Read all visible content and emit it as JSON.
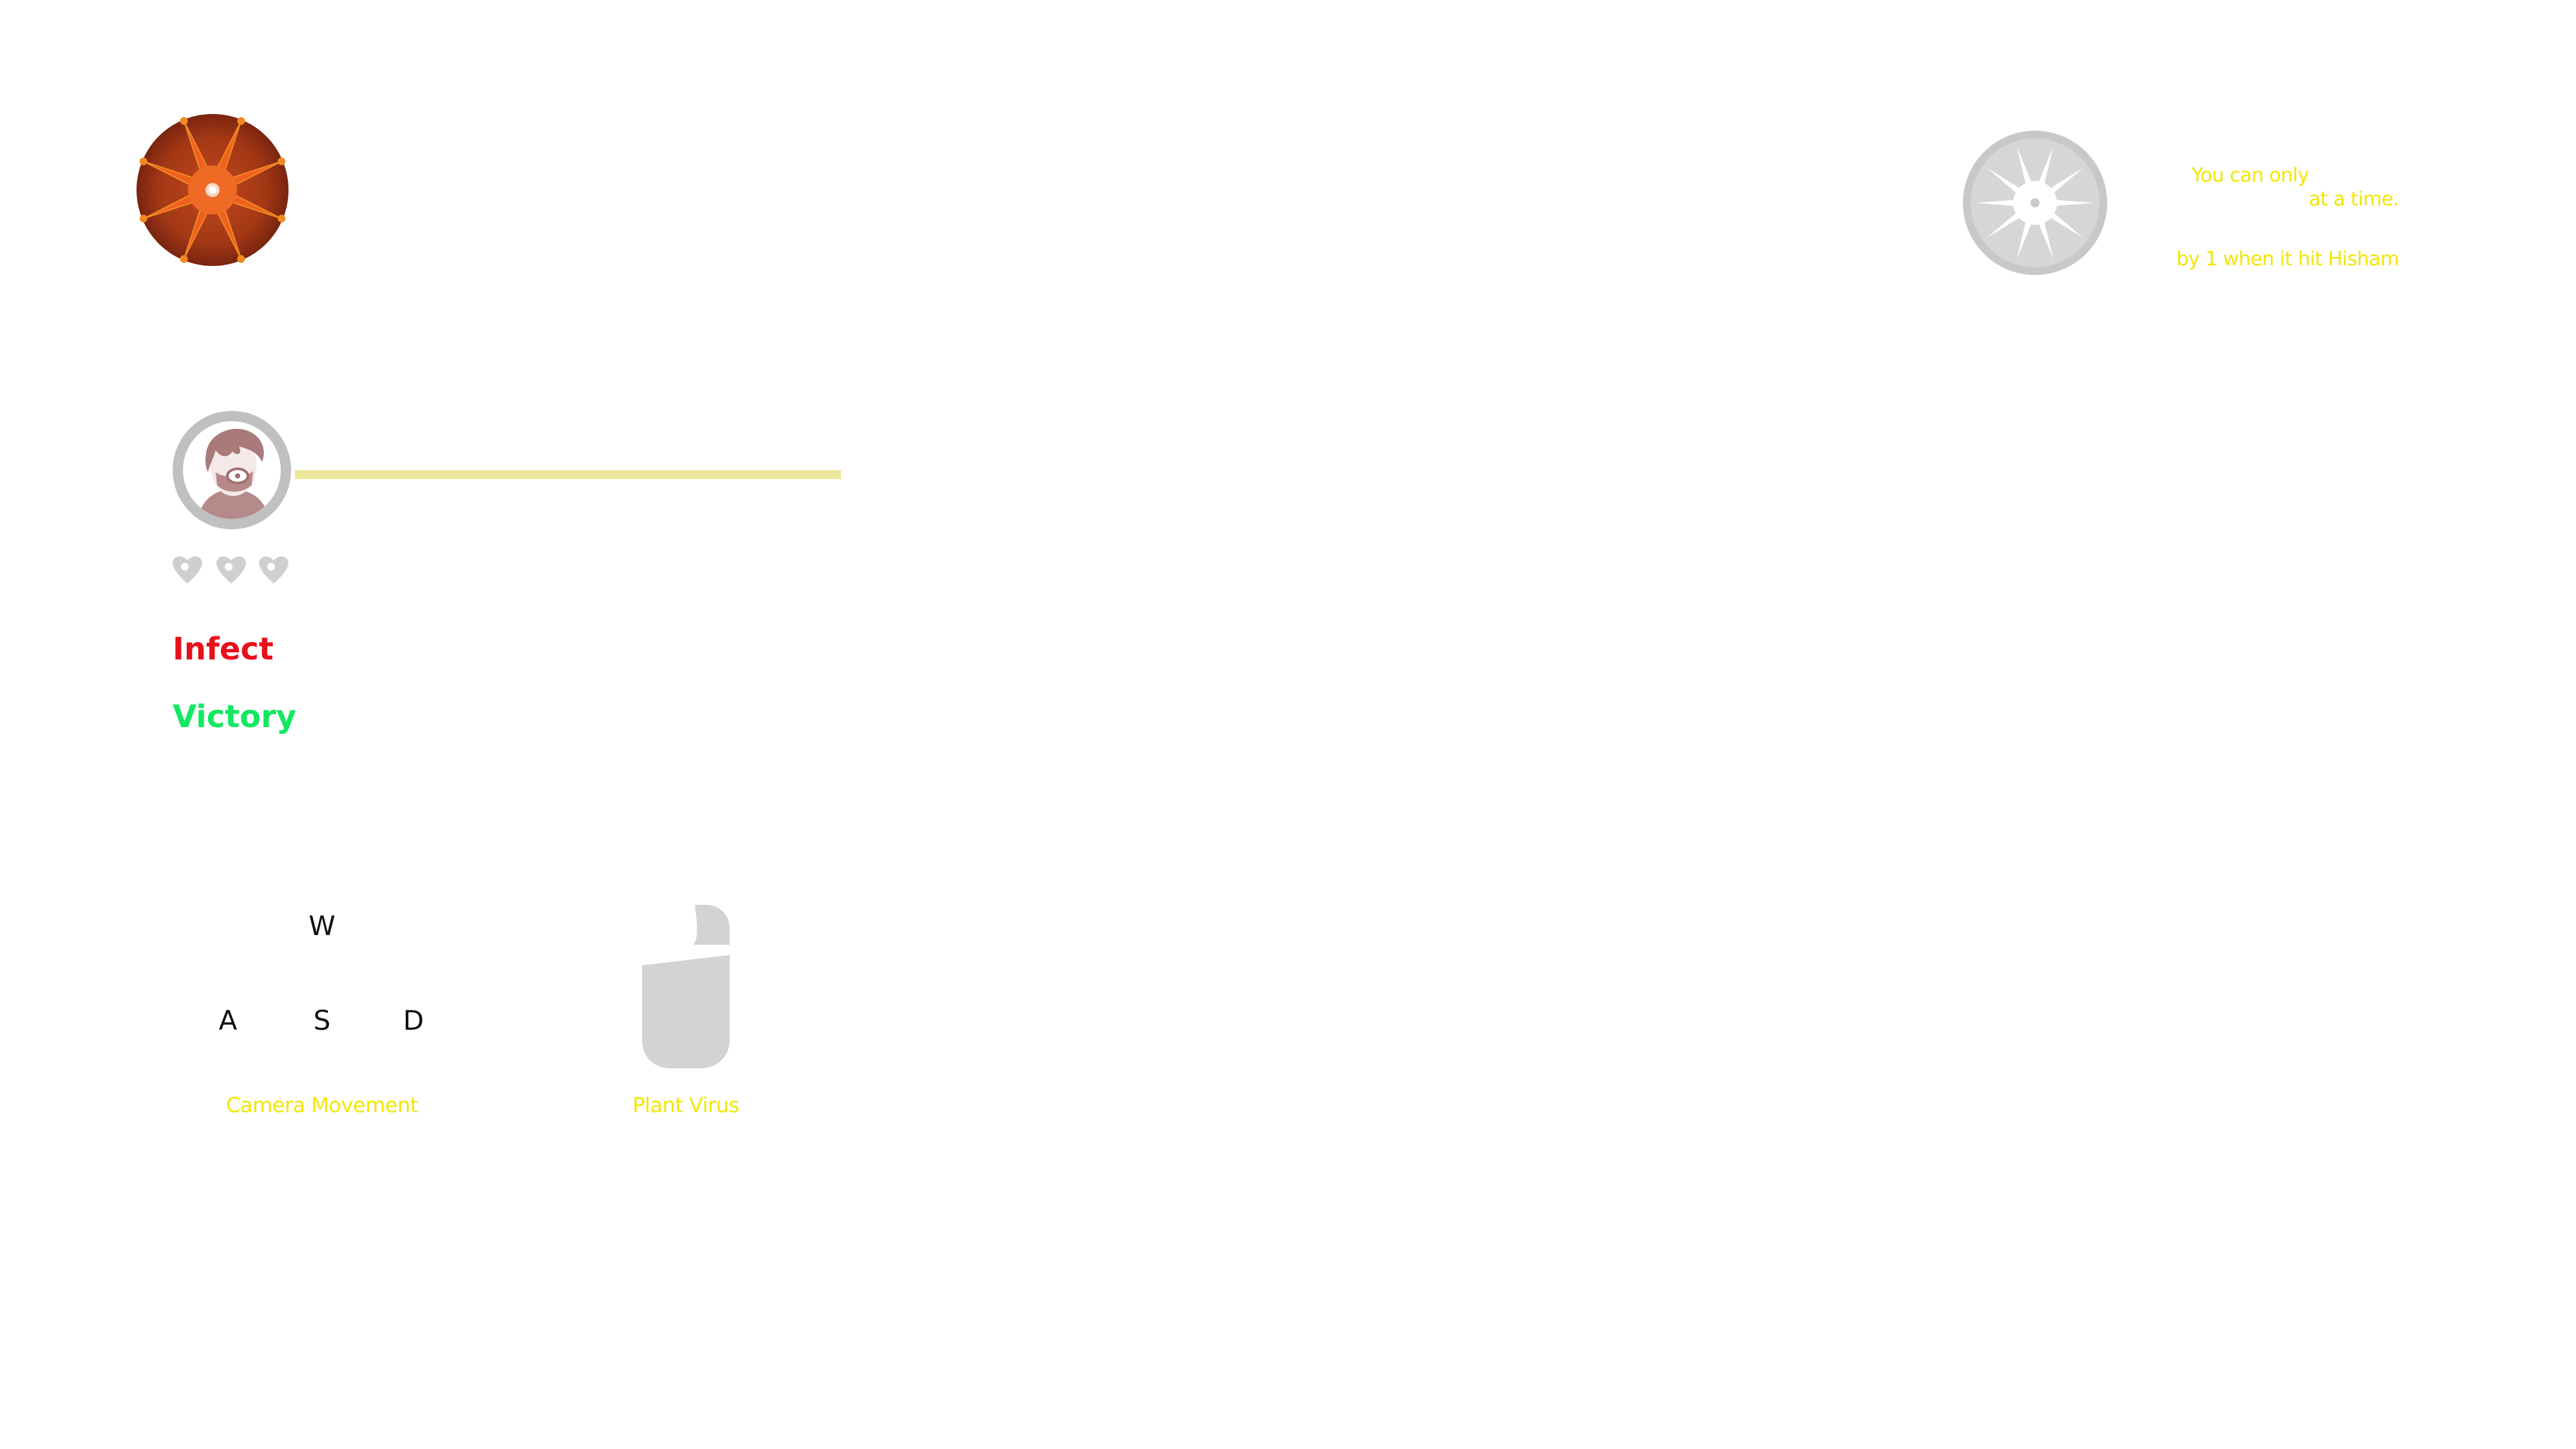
{
  "hud": {
    "virus_icon": "virus-emblem-icon",
    "tip": {
      "icon": "virus-silhouette-icon",
      "line_1": "You can only",
      "line_2": "at a time.",
      "line_3": "by 1 when it hit Hisham"
    }
  },
  "target": {
    "avatar_icon": "masked-person-avatar",
    "progress": 0.0,
    "lives": {
      "icon": "heart-icon",
      "count": 3
    },
    "status": {
      "infect": "Infect",
      "victory": "Victory"
    }
  },
  "controls": {
    "keys": {
      "up": "W",
      "left": "A",
      "down": "S",
      "right": "D"
    },
    "camera_label": "Camera Movement",
    "mouse_icon": "mouse-icon",
    "plant_label": "Plant Virus"
  },
  "colors": {
    "tip_text": "#f3e600",
    "infect": "#e8101a",
    "victory": "#12e860",
    "bar": "#ece69a",
    "icon_grey": "#c8c8c8",
    "virus_outer": "#8f2e12",
    "virus_inner": "#ef6020"
  }
}
